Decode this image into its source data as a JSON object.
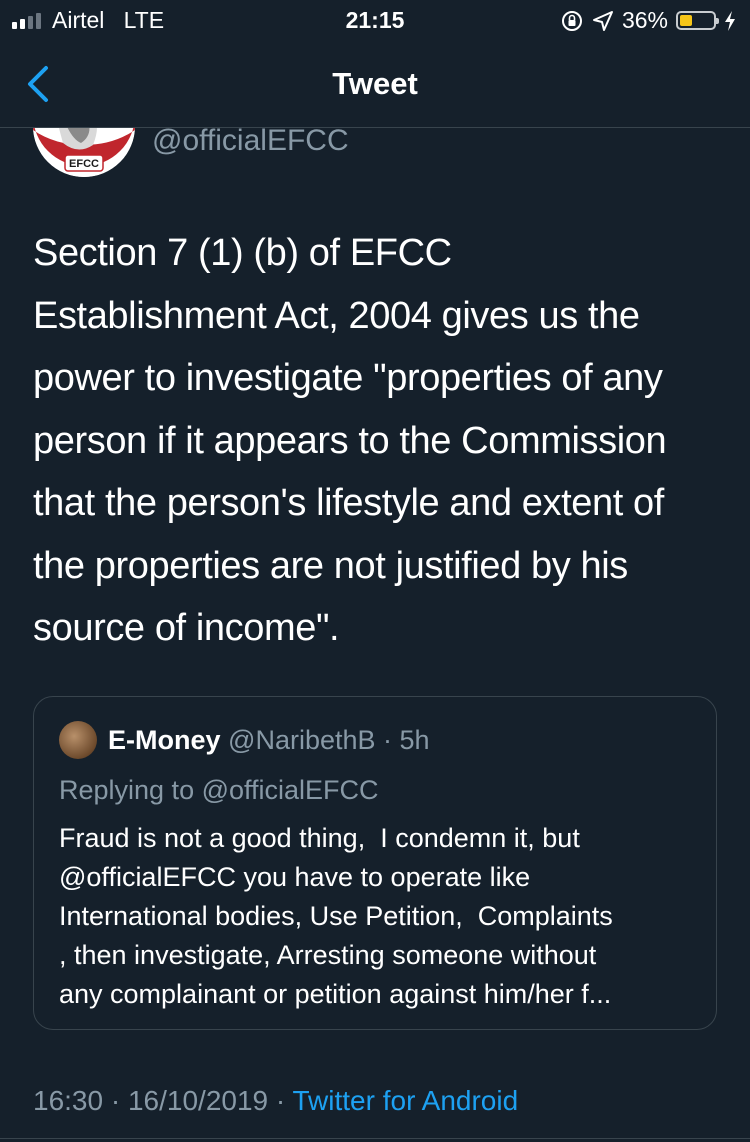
{
  "status_bar": {
    "carrier": "Airtel",
    "network": "LTE",
    "time": "21:15",
    "battery_percent": "36%",
    "battery_level": 0.36,
    "battery_color": "#f5c518"
  },
  "nav": {
    "back_icon": "chevron-left-icon",
    "title": "Tweet"
  },
  "tweet": {
    "author_handle": "@officialEFCC",
    "avatar_label": "EFCC",
    "lines": [
      "Section 7 (1) (b) of EFCC",
      "Establishment Act, 2004 gives us the",
      "power to investigate \"properties of any",
      "person if it appears to the Commission",
      "that the person's lifestyle and extent of",
      "the properties are not justified by his",
      "source of income\"."
    ],
    "timestamp_time": "16:30",
    "timestamp_date": "16/10/2019",
    "source": "Twitter for Android"
  },
  "quote": {
    "name": "E-Money",
    "handle": "@NaribethB",
    "time": "5h",
    "replying_to": "Replying to @officialEFCC",
    "lines": [
      "Fraud is not a good thing,  I condemn it, but",
      "@officialEFCC you have to operate like",
      "International bodies, Use Petition,  Complaints",
      ", then investigate, Arresting someone without",
      "any complainant or petition against him/her f..."
    ]
  },
  "colors": {
    "background": "#15202b",
    "text_primary": "#ffffff",
    "text_secondary": "#8899a6",
    "accent": "#1da1f2",
    "border": "#38444d"
  }
}
